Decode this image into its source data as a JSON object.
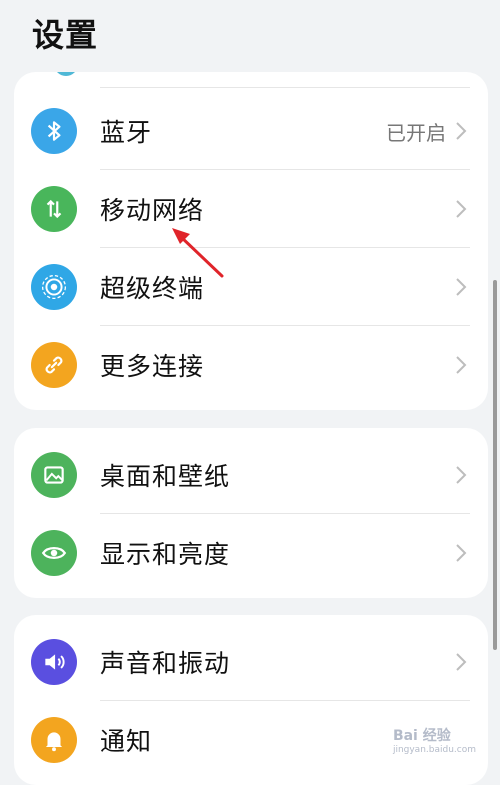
{
  "header": {
    "title": "设置"
  },
  "groups": [
    {
      "items": [
        {
          "label": "蓝牙",
          "value": "已开启",
          "icon": "bluetooth-icon",
          "color": "#3aa6e8"
        },
        {
          "label": "移动网络",
          "value": "",
          "icon": "mobile-data-icon",
          "color": "#49b65b"
        },
        {
          "label": "超级终端",
          "value": "",
          "icon": "super-device-icon",
          "color": "#2fa7e6"
        },
        {
          "label": "更多连接",
          "value": "",
          "icon": "link-icon",
          "color": "#f3a51f"
        }
      ]
    },
    {
      "items": [
        {
          "label": "桌面和壁纸",
          "value": "",
          "icon": "wallpaper-icon",
          "color": "#4db35c"
        },
        {
          "label": "显示和亮度",
          "value": "",
          "icon": "eye-icon",
          "color": "#4db35c"
        }
      ]
    },
    {
      "items": [
        {
          "label": "声音和振动",
          "value": "",
          "icon": "sound-icon",
          "color": "#5a4fe0"
        },
        {
          "label": "通知",
          "value": "",
          "icon": "bell-icon",
          "color": "#f3a51f"
        }
      ]
    }
  ],
  "colors": {
    "background": "#f1f3f5",
    "card": "#ffffff",
    "annotation_arrow": "#e0242a"
  },
  "watermark": {
    "text": "Bai 经验",
    "sub": "jingyan.baidu.com"
  }
}
